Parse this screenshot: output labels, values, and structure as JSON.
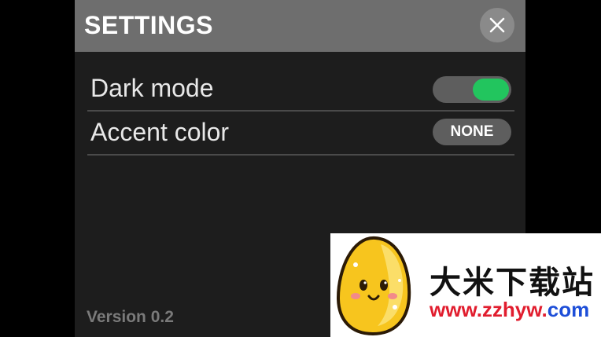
{
  "header": {
    "title": "SETTINGS",
    "close_icon": "close-icon"
  },
  "settings": {
    "dark_mode": {
      "label": "Dark mode",
      "enabled": true
    },
    "accent_color": {
      "label": "Accent color",
      "value": "NONE"
    }
  },
  "footer": {
    "version": "Version 0.2"
  },
  "watermark": {
    "name": "大米下载站",
    "url_red": "www.zzhyw.",
    "url_blue": "com",
    "logo_icon": "egg-mascot-icon"
  },
  "colors": {
    "toggle_on": "#22c55e",
    "titlebar": "#6e6e6e",
    "panel": "#1d1d1d"
  }
}
